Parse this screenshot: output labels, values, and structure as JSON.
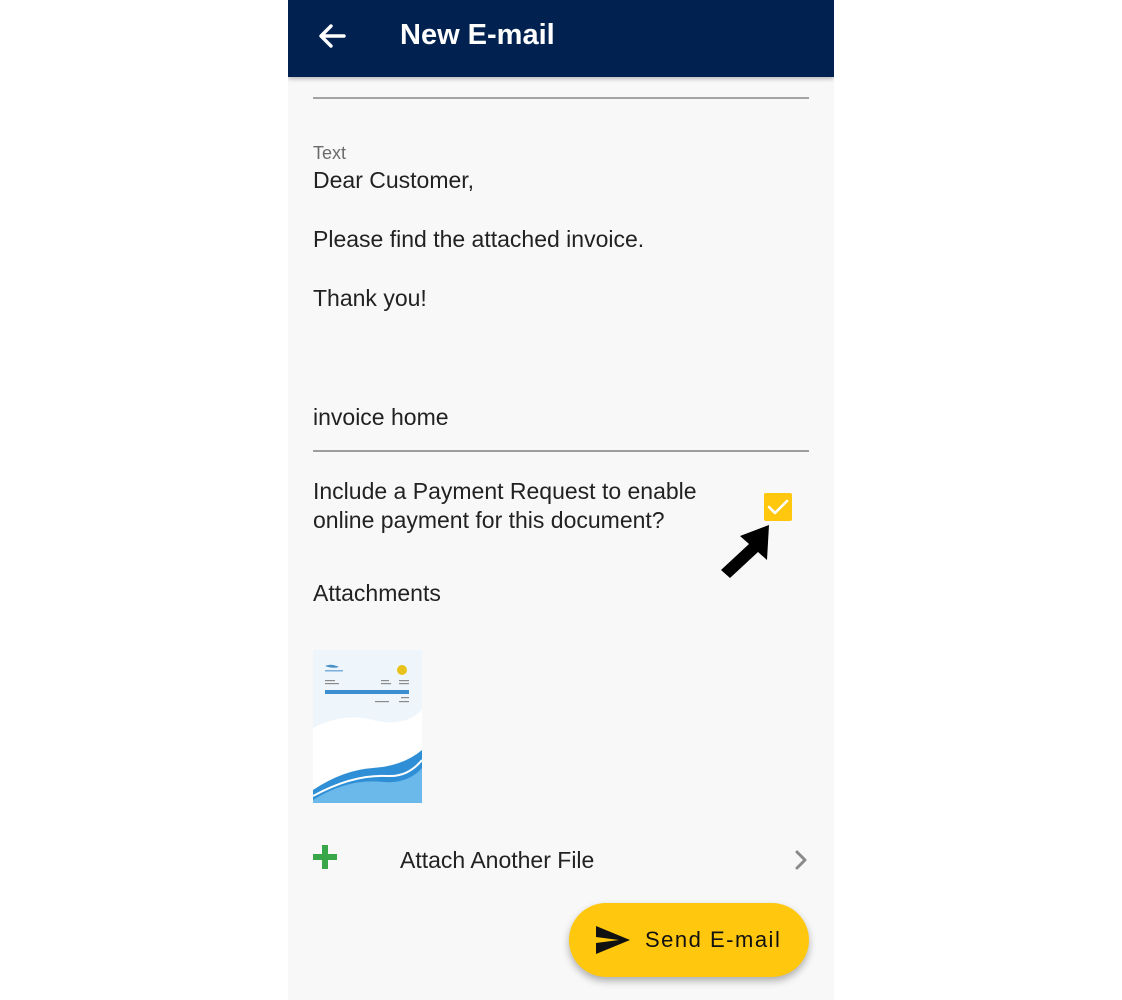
{
  "appbar": {
    "title": "New E-mail",
    "back_icon": "arrow-left-icon",
    "background": "#012251"
  },
  "body": {
    "label": "Text",
    "lines": [
      "Dear Customer,",
      "",
      "Please find the attached invoice.",
      "",
      "Thank you!"
    ]
  },
  "subject": {
    "value": "invoice home"
  },
  "payment_request": {
    "label": "Include a Payment Request to enable online payment for this document?",
    "checked": true,
    "checkbox_color": "#ffc70d"
  },
  "attachments": {
    "heading": "Attachments",
    "files": [
      {
        "type": "invoice-thumbnail"
      }
    ],
    "add_label": "Attach Another File",
    "add_icon": "plus-icon",
    "chevron_icon": "chevron-right-icon"
  },
  "send_button": {
    "label": "Send E-mail",
    "icon": "send-icon",
    "color": "#ffc70d"
  }
}
